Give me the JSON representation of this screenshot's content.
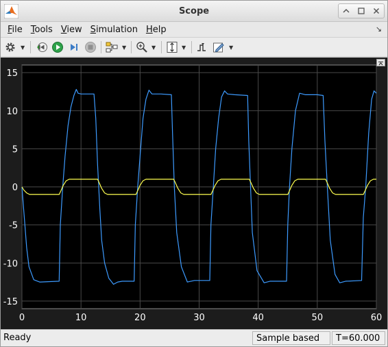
{
  "window": {
    "title": "Scope"
  },
  "menubar": {
    "items": [
      {
        "label": "File",
        "mnemonic": "F",
        "rest": "ile"
      },
      {
        "label": "Tools",
        "mnemonic": "T",
        "rest": "ools"
      },
      {
        "label": "View",
        "mnemonic": "V",
        "rest": "iew"
      },
      {
        "label": "Simulation",
        "mnemonic": "S",
        "rest": "imulation"
      },
      {
        "label": "Help",
        "mnemonic": "H",
        "rest": "elp"
      }
    ]
  },
  "toolbar": {
    "icons": [
      "gear-icon",
      "step-back-icon",
      "run-icon",
      "step-forward-icon",
      "stop-icon",
      "signal-selector-icon",
      "zoom-icon",
      "scale-axes-icon",
      "trigger-icon",
      "edit-icon"
    ]
  },
  "status": {
    "left": "Ready",
    "mode": "Sample based",
    "time": "T=60.000"
  },
  "colors": {
    "scope_bg": "#000000",
    "axes_text": "#ffffff",
    "grid": "#4a4a4a",
    "series_blue": "#3d9bff",
    "series_yellow": "#ffff50"
  },
  "chart_data": {
    "type": "line",
    "xlim": [
      0,
      60
    ],
    "ylim": [
      -16,
      16
    ],
    "xticks": [
      0,
      10,
      20,
      30,
      40,
      50,
      60
    ],
    "yticks": [
      -15,
      -10,
      -5,
      0,
      5,
      10,
      15
    ],
    "grid": true,
    "series": [
      {
        "color": "#3d9bff",
        "x": [
          0,
          0.2,
          0.5,
          0.8,
          1.2,
          2.0,
          3.0,
          6.3,
          6.5,
          6.9,
          7.3,
          7.8,
          8.3,
          8.8,
          9.2,
          9.5,
          10.0,
          10.7,
          11.5,
          12.2,
          12.5,
          12.8,
          13.0,
          13.2,
          13.5,
          14.0,
          14.7,
          15.5,
          16.2,
          17.0,
          19.0,
          19.2,
          19.6,
          20.0,
          20.5,
          21.0,
          21.5,
          22.0,
          23.5,
          25.3,
          25.5,
          25.8,
          26.2,
          27.0,
          28.0,
          29.2,
          31.8,
          32.0,
          32.4,
          32.8,
          33.3,
          33.8,
          34.3,
          34.8,
          36.0,
          38.2,
          38.4,
          38.7,
          39.0,
          39.8,
          41.0,
          42.0,
          44.8,
          45.0,
          45.3,
          45.7,
          46.3,
          47.0,
          47.5,
          48.0,
          50.0,
          51.0,
          51.3,
          51.7,
          52.2,
          53.0,
          53.8,
          54.8,
          57.5,
          57.8,
          58.2,
          58.7,
          59.2,
          59.6,
          60.0
        ],
        "y": [
          0,
          -2,
          -5,
          -8,
          -10.5,
          -12.2,
          -12.5,
          -12.4,
          -5,
          0,
          4,
          8,
          10.5,
          12,
          12.8,
          12.3,
          12.2,
          12.2,
          12.2,
          12.2,
          9,
          3,
          0,
          -3,
          -7,
          -10,
          -12,
          -12.8,
          -12.5,
          -12.4,
          -12.4,
          -5,
          0,
          4,
          9,
          11.5,
          12.7,
          12.2,
          12.2,
          12.1,
          7,
          0,
          -6,
          -10.5,
          -12.5,
          -12.3,
          -12.3,
          -5,
          0,
          5,
          9,
          11.8,
          12.6,
          12.2,
          12.1,
          12.0,
          6,
          0,
          -6,
          -11,
          -12.6,
          -12.4,
          -12.4,
          -5,
          0,
          5,
          10,
          12.3,
          12.2,
          12.1,
          12.1,
          12.0,
          6,
          0,
          -7,
          -11.5,
          -12.6,
          -12.4,
          -12.3,
          -4,
          0,
          7,
          11.5,
          12.6,
          12.3
        ]
      },
      {
        "color": "#ffff50",
        "x": [
          0,
          0.3,
          0.8,
          1.3,
          2.0,
          6.3,
          6.6,
          7.0,
          7.5,
          8.0,
          12.8,
          13.1,
          13.5,
          14.0,
          14.5,
          19.3,
          19.6,
          20.0,
          20.5,
          21.0,
          25.7,
          26.0,
          26.4,
          26.9,
          27.4,
          32.0,
          32.3,
          32.7,
          33.2,
          33.7,
          38.5,
          38.8,
          39.2,
          39.7,
          40.2,
          45.0,
          45.3,
          45.7,
          46.2,
          46.7,
          51.4,
          51.7,
          52.1,
          52.6,
          53.1,
          57.8,
          58.1,
          58.5,
          59.0,
          59.5,
          60.0
        ],
        "y": [
          0,
          -0.4,
          -0.8,
          -1.0,
          -1.0,
          -1.0,
          -0.5,
          0.2,
          0.8,
          1.0,
          1.0,
          0.5,
          -0.2,
          -0.8,
          -1.0,
          -1.0,
          -0.5,
          0.2,
          0.8,
          1.0,
          1.0,
          0.5,
          -0.2,
          -0.8,
          -1.0,
          -1.0,
          -0.5,
          0.2,
          0.8,
          1.0,
          1.0,
          0.5,
          -0.2,
          -0.8,
          -1.0,
          -1.0,
          -0.5,
          0.2,
          0.8,
          1.0,
          1.0,
          0.5,
          -0.2,
          -0.8,
          -1.0,
          -1.0,
          -0.5,
          0.2,
          0.8,
          1.0,
          1.0
        ]
      }
    ]
  }
}
